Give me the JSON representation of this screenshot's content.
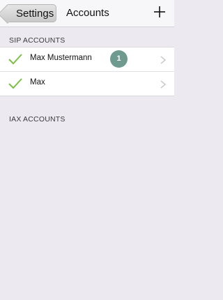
{
  "navbar": {
    "back_label": "Settings",
    "title": "Accounts",
    "add_icon": "plus-icon"
  },
  "sip": {
    "header": "SIP ACCOUNTS",
    "accounts": [
      {
        "name": "Max Mustermann",
        "enabled": true,
        "badge": "1"
      },
      {
        "name": "Max",
        "enabled": true,
        "badge": ""
      }
    ]
  },
  "iax": {
    "header": "IAX ACCOUNTS"
  },
  "colors": {
    "check": "#7bc043",
    "badge": "#6f9a8f",
    "background": "#eceaf0"
  }
}
